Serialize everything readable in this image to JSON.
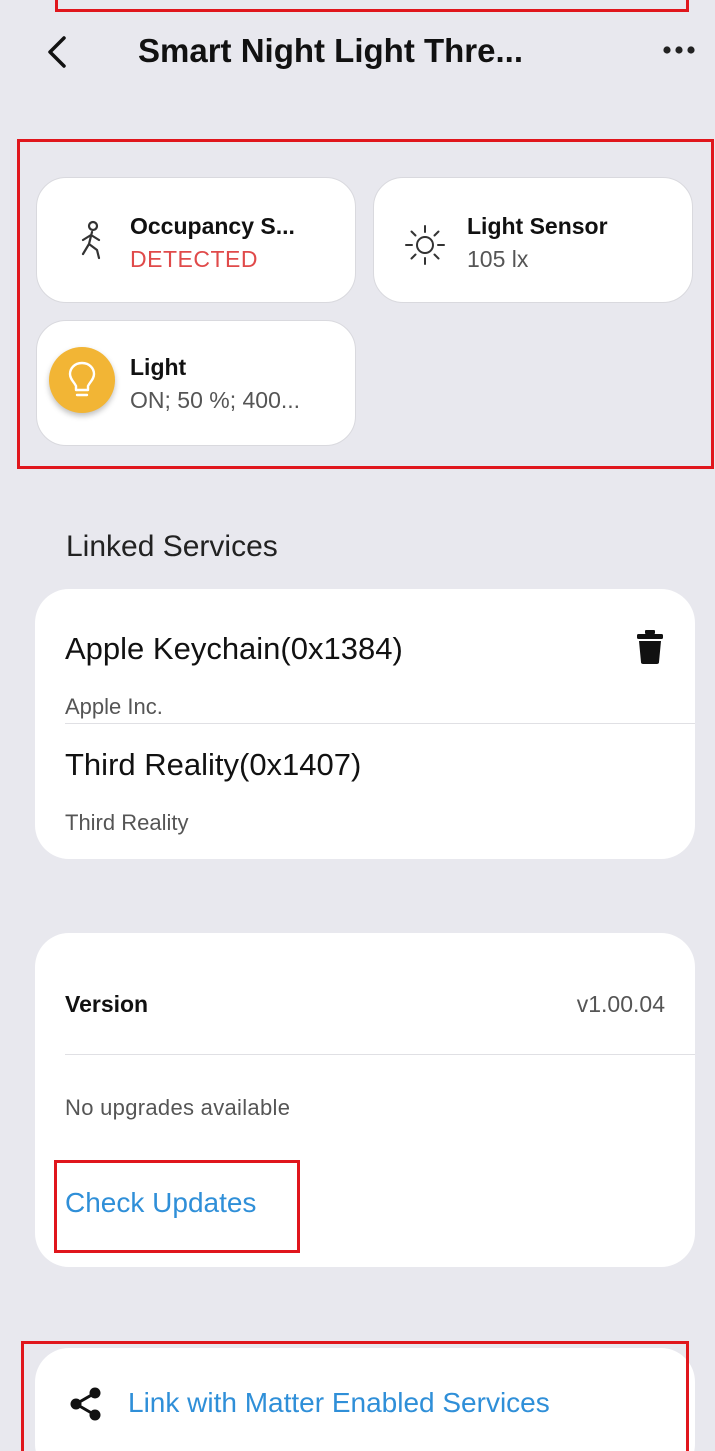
{
  "header": {
    "title": "Smart Night Light Thre...",
    "back_icon": "chevron-left-icon",
    "more_icon": "more-horizontal-icon"
  },
  "tiles": [
    {
      "name": "Occupancy S...",
      "value": "DETECTED",
      "icon": "walking-person-icon"
    },
    {
      "name": "Light Sensor",
      "value": "105 lx",
      "icon": "sun-icon"
    },
    {
      "name": "Light",
      "value": "ON; 50 %; 400...",
      "icon": "lightbulb-icon"
    }
  ],
  "linked_services": {
    "label": "Linked Services",
    "items": [
      {
        "name": "Apple Keychain(0x1384)",
        "vendor": "Apple Inc."
      },
      {
        "name": "Third Reality(0x1407)",
        "vendor": "Third Reality"
      }
    ],
    "delete_icon": "trash-icon"
  },
  "version": {
    "label": "Version",
    "value": "v1.00.04",
    "status": "No upgrades available",
    "check_label": "Check Updates"
  },
  "link": {
    "label": "Link with Matter Enabled Services",
    "icon": "share-icon"
  },
  "colors": {
    "background": "#e8e8ee",
    "alert": "#e04a4a",
    "link": "#2f8fd8",
    "bulb": "#f2b535",
    "highlight": "#e0161c"
  }
}
